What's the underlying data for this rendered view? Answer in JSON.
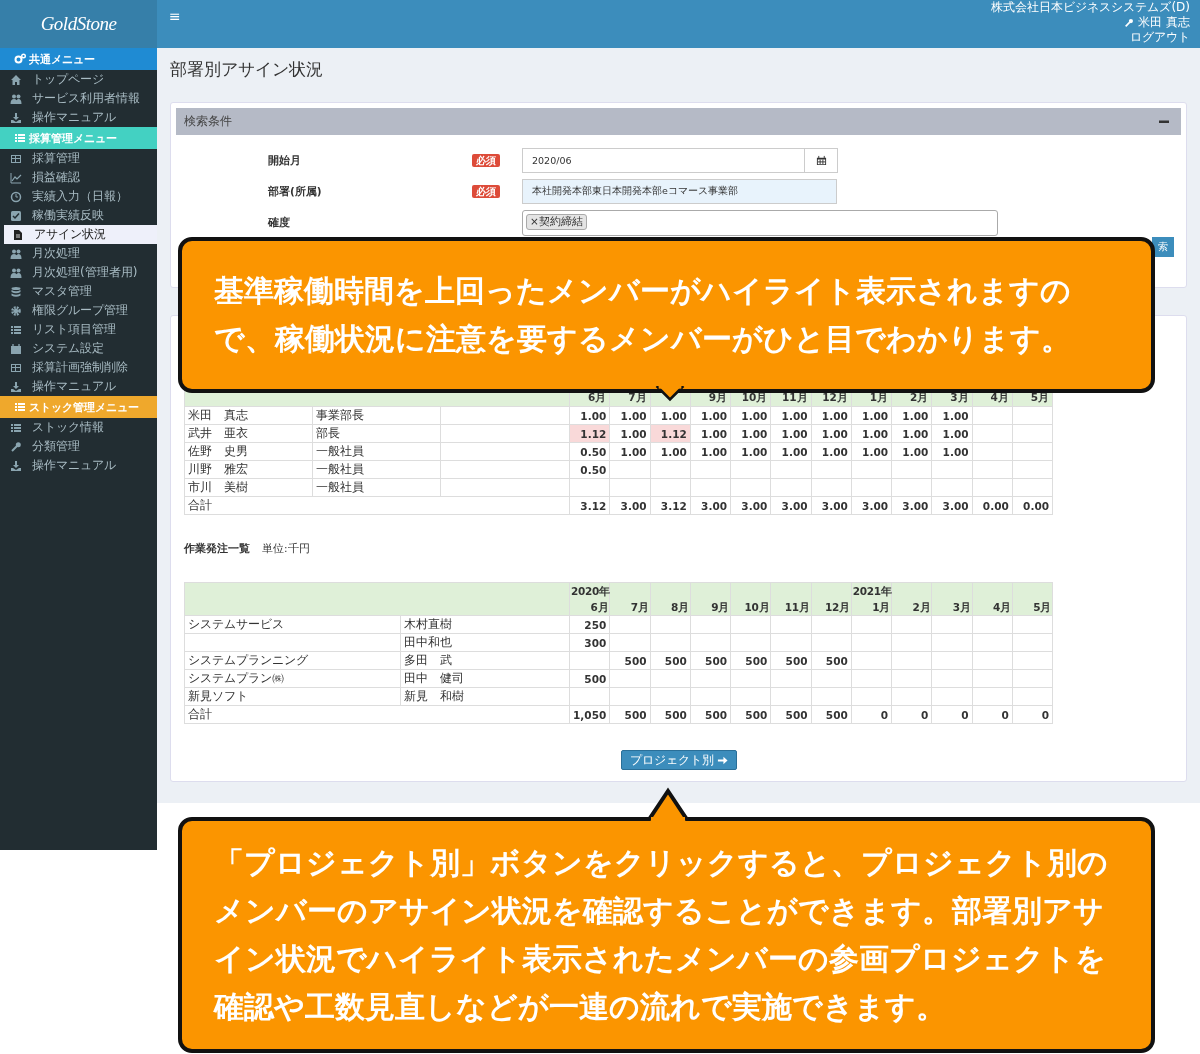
{
  "header": {
    "logo": "GoldStone",
    "menu_toggle": "≡",
    "company": "株式会社日本ビジネスシステムズ(D)",
    "user": "米田 真志",
    "logout": "ログアウト"
  },
  "sidebar": {
    "sections": [
      {
        "title": "共通メニュー",
        "color": "#1f8bd3",
        "items": [
          {
            "label": "トップページ",
            "selected": false
          },
          {
            "label": "サービス利用者情報",
            "selected": false
          },
          {
            "label": "操作マニュアル",
            "selected": false
          }
        ]
      },
      {
        "title": "採算管理メニュー",
        "color": "#43d1c2",
        "items": [
          {
            "label": "採算管理",
            "selected": false
          },
          {
            "label": "損益確認",
            "selected": false
          },
          {
            "label": "実績入力（日報）",
            "selected": false
          },
          {
            "label": "稼働実績反映",
            "selected": false
          },
          {
            "label": "アサイン状況",
            "selected": true
          },
          {
            "label": "月次処理",
            "selected": false
          },
          {
            "label": "月次処理(管理者用)",
            "selected": false
          },
          {
            "label": "マスタ管理",
            "selected": false
          },
          {
            "label": "権限グループ管理",
            "selected": false
          },
          {
            "label": "リスト項目管理",
            "selected": false
          },
          {
            "label": "システム設定",
            "selected": false
          },
          {
            "label": "採算計画強制削除",
            "selected": false
          },
          {
            "label": "操作マニュアル",
            "selected": false
          }
        ]
      },
      {
        "title": "ストック管理メニュー",
        "color": "#efa82c",
        "items": [
          {
            "label": "ストック情報",
            "selected": false
          },
          {
            "label": "分類管理",
            "selected": false
          },
          {
            "label": "操作マニュアル",
            "selected": false
          }
        ]
      }
    ]
  },
  "page_title": "部署別アサイン状況",
  "search_panel": {
    "title": "検索条件",
    "fields": [
      {
        "kind": "date",
        "label": "開始月",
        "required": true,
        "badge": "必須",
        "value": "2020/06"
      },
      {
        "kind": "text",
        "label": "部署(所属)",
        "required": true,
        "badge": "必須",
        "value": "本社開発本部東日本開発本部eコマース事業部"
      },
      {
        "kind": "tags",
        "label": "確度",
        "required": false,
        "tags": [
          {
            "remove": "×",
            "label": "契約締結"
          }
        ]
      }
    ],
    "search_button": "索"
  },
  "assign_table": {
    "months": [
      {
        "month": "6月",
        "covered": false
      },
      {
        "month": "7月",
        "covered": false
      },
      {
        "covered": true
      },
      {
        "month": "9月",
        "covered": false
      },
      {
        "month": "10月",
        "covered": false
      },
      {
        "month": "11月",
        "covered": false
      },
      {
        "month": "12月",
        "covered": false
      },
      {
        "month": "1月",
        "covered": false
      },
      {
        "month": "2月",
        "covered": false
      },
      {
        "month": "3月",
        "covered": false
      },
      {
        "month": "4月",
        "covered": false
      },
      {
        "month": "5月",
        "covered": false
      }
    ],
    "rows": [
      {
        "name": "米田　真志",
        "title": "事業部長",
        "cells": [
          {
            "text": "1.00",
            "highlighted": false
          },
          {
            "text": "1.00",
            "highlighted": false
          },
          {
            "text": "1.00",
            "highlighted": false
          },
          {
            "text": "1.00",
            "highlighted": false
          },
          {
            "text": "1.00",
            "highlighted": false
          },
          {
            "text": "1.00",
            "highlighted": false
          },
          {
            "text": "1.00",
            "highlighted": false
          },
          {
            "text": "1.00",
            "highlighted": false
          },
          {
            "text": "1.00",
            "highlighted": false
          },
          {
            "text": "1.00",
            "highlighted": false
          },
          {
            "highlighted": false
          },
          {
            "highlighted": false
          }
        ]
      },
      {
        "name": "武井　亜衣",
        "title": "部長",
        "cells": [
          {
            "text": "1.12",
            "highlighted": true
          },
          {
            "text": "1.00",
            "highlighted": false
          },
          {
            "text": "1.12",
            "highlighted": true
          },
          {
            "text": "1.00",
            "highlighted": false
          },
          {
            "text": "1.00",
            "highlighted": false
          },
          {
            "text": "1.00",
            "highlighted": false
          },
          {
            "text": "1.00",
            "highlighted": false
          },
          {
            "text": "1.00",
            "highlighted": false
          },
          {
            "text": "1.00",
            "highlighted": false
          },
          {
            "text": "1.00",
            "highlighted": false
          },
          {
            "highlighted": false
          },
          {
            "highlighted": false
          }
        ]
      },
      {
        "name": "佐野　史男",
        "title": "一般社員",
        "cells": [
          {
            "text": "0.50",
            "highlighted": false
          },
          {
            "text": "1.00",
            "highlighted": false
          },
          {
            "text": "1.00",
            "highlighted": false
          },
          {
            "text": "1.00",
            "highlighted": false
          },
          {
            "text": "1.00",
            "highlighted": false
          },
          {
            "text": "1.00",
            "highlighted": false
          },
          {
            "text": "1.00",
            "highlighted": false
          },
          {
            "text": "1.00",
            "highlighted": false
          },
          {
            "text": "1.00",
            "highlighted": false
          },
          {
            "text": "1.00",
            "highlighted": false
          },
          {
            "highlighted": false
          },
          {
            "highlighted": false
          }
        ]
      },
      {
        "name": "川野　雅宏",
        "title": "一般社員",
        "cells": [
          {
            "text": "0.50",
            "highlighted": false
          },
          {
            "highlighted": false
          },
          {
            "highlighted": false
          },
          {
            "highlighted": false
          },
          {
            "highlighted": false
          },
          {
            "highlighted": false
          },
          {
            "highlighted": false
          },
          {
            "highlighted": false
          },
          {
            "highlighted": false
          },
          {
            "highlighted": false
          },
          {
            "highlighted": false
          },
          {
            "highlighted": false
          }
        ]
      },
      {
        "name": "市川　美樹",
        "title": "一般社員",
        "cells": [
          {
            "highlighted": false
          },
          {
            "highlighted": false
          },
          {
            "highlighted": false
          },
          {
            "highlighted": false
          },
          {
            "highlighted": false
          },
          {
            "highlighted": false
          },
          {
            "highlighted": false
          },
          {
            "highlighted": false
          },
          {
            "highlighted": false
          },
          {
            "highlighted": false
          },
          {
            "highlighted": false
          },
          {
            "highlighted": false
          }
        ]
      }
    ],
    "total": {
      "label": "合計",
      "values": [
        "3.12",
        "3.00",
        "3.12",
        "3.00",
        "3.00",
        "3.00",
        "3.00",
        "3.00",
        "3.00",
        "3.00",
        "0.00",
        "0.00"
      ]
    }
  },
  "order_table": {
    "title": "作業発注一覧",
    "unit": "単位:千円",
    "months": [
      {
        "year": "2020年",
        "month": "6月"
      },
      {
        "month": "7月"
      },
      {
        "month": "8月"
      },
      {
        "month": "9月"
      },
      {
        "month": "10月"
      },
      {
        "month": "11月"
      },
      {
        "month": "12月"
      },
      {
        "year": "2021年",
        "month": "1月"
      },
      {
        "month": "2月"
      },
      {
        "month": "3月"
      },
      {
        "month": "4月"
      },
      {
        "month": "5月"
      }
    ],
    "rows": [
      {
        "company": "システムサービス",
        "person": "木村直樹",
        "cells": [
          {
            "text": "250"
          },
          {},
          {},
          {},
          {},
          {},
          {},
          {},
          {},
          {},
          {},
          {}
        ]
      },
      {
        "person": "田中和也",
        "cells": [
          {
            "text": "300"
          },
          {},
          {},
          {},
          {},
          {},
          {},
          {},
          {},
          {},
          {},
          {}
        ]
      },
      {
        "company": "システムプランニング",
        "person": "多田　武",
        "cells": [
          {},
          {
            "text": "500"
          },
          {
            "text": "500"
          },
          {
            "text": "500"
          },
          {
            "text": "500"
          },
          {
            "text": "500"
          },
          {
            "text": "500"
          },
          {},
          {},
          {},
          {},
          {}
        ]
      },
      {
        "company": "システムプラン㈱",
        "person": "田中　健司",
        "cells": [
          {
            "text": "500"
          },
          {},
          {},
          {},
          {},
          {},
          {},
          {},
          {},
          {},
          {},
          {}
        ]
      },
      {
        "company": "新見ソフト",
        "person": "新見　和樹",
        "cells": [
          {},
          {},
          {},
          {},
          {},
          {},
          {},
          {},
          {},
          {},
          {},
          {}
        ]
      }
    ],
    "total": {
      "label": "合計",
      "values": [
        "1,050",
        "500",
        "500",
        "500",
        "500",
        "500",
        "500",
        "0",
        "0",
        "0",
        "0",
        "0"
      ]
    }
  },
  "project_button": "プロジェクト別",
  "callouts": [
    {
      "text": "基準稼働時間を上回ったメンバーがハイライト表示されますので、稼働状況に注意を要するメンバーがひと目でわかります。"
    },
    {
      "text": "「プロジェクト別」ボタンをクリックすると、プロジェクト別のメンバーのアサイン状況を確認することができます。部署別アサイン状況でハイライト表示されたメンバーの参画プロジェクトを確認や工数見直しなどが一連の流れで実施できます。"
    }
  ]
}
